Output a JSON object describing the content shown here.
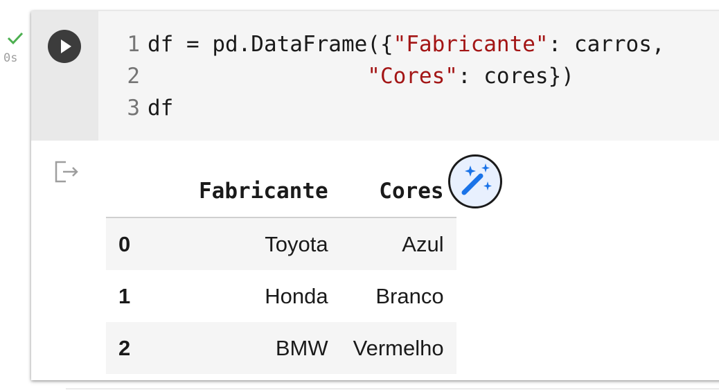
{
  "execution": {
    "status_icon": "check-icon",
    "time": "0s",
    "status_color": "#4caf50"
  },
  "cell": {
    "run_icon": "play-icon",
    "code_lines": [
      {
        "num": "1",
        "text": ""
      },
      {
        "num": "2",
        "text": ""
      },
      {
        "num": "3",
        "text": "df"
      }
    ],
    "code_tokens": {
      "l1_a": "df = pd.DataFrame({",
      "l1_str": "\"Fabricante\"",
      "l1_b": ": carros,",
      "l2_pad": "                 ",
      "l2_str": "\"Cores\"",
      "l2_b": ": cores})"
    },
    "string_color": "#a31515"
  },
  "output": {
    "icon": "output-redirect-icon",
    "table": {
      "columns": [
        "",
        "Fabricante",
        "Cores"
      ],
      "rows": [
        {
          "index": "0",
          "Fabricante": "Toyota",
          "Cores": "Azul"
        },
        {
          "index": "1",
          "Fabricante": "Honda",
          "Cores": "Branco"
        },
        {
          "index": "2",
          "Fabricante": "BMW",
          "Cores": "Vermelho"
        }
      ]
    },
    "suggest_icon": "magic-wand-icon"
  }
}
